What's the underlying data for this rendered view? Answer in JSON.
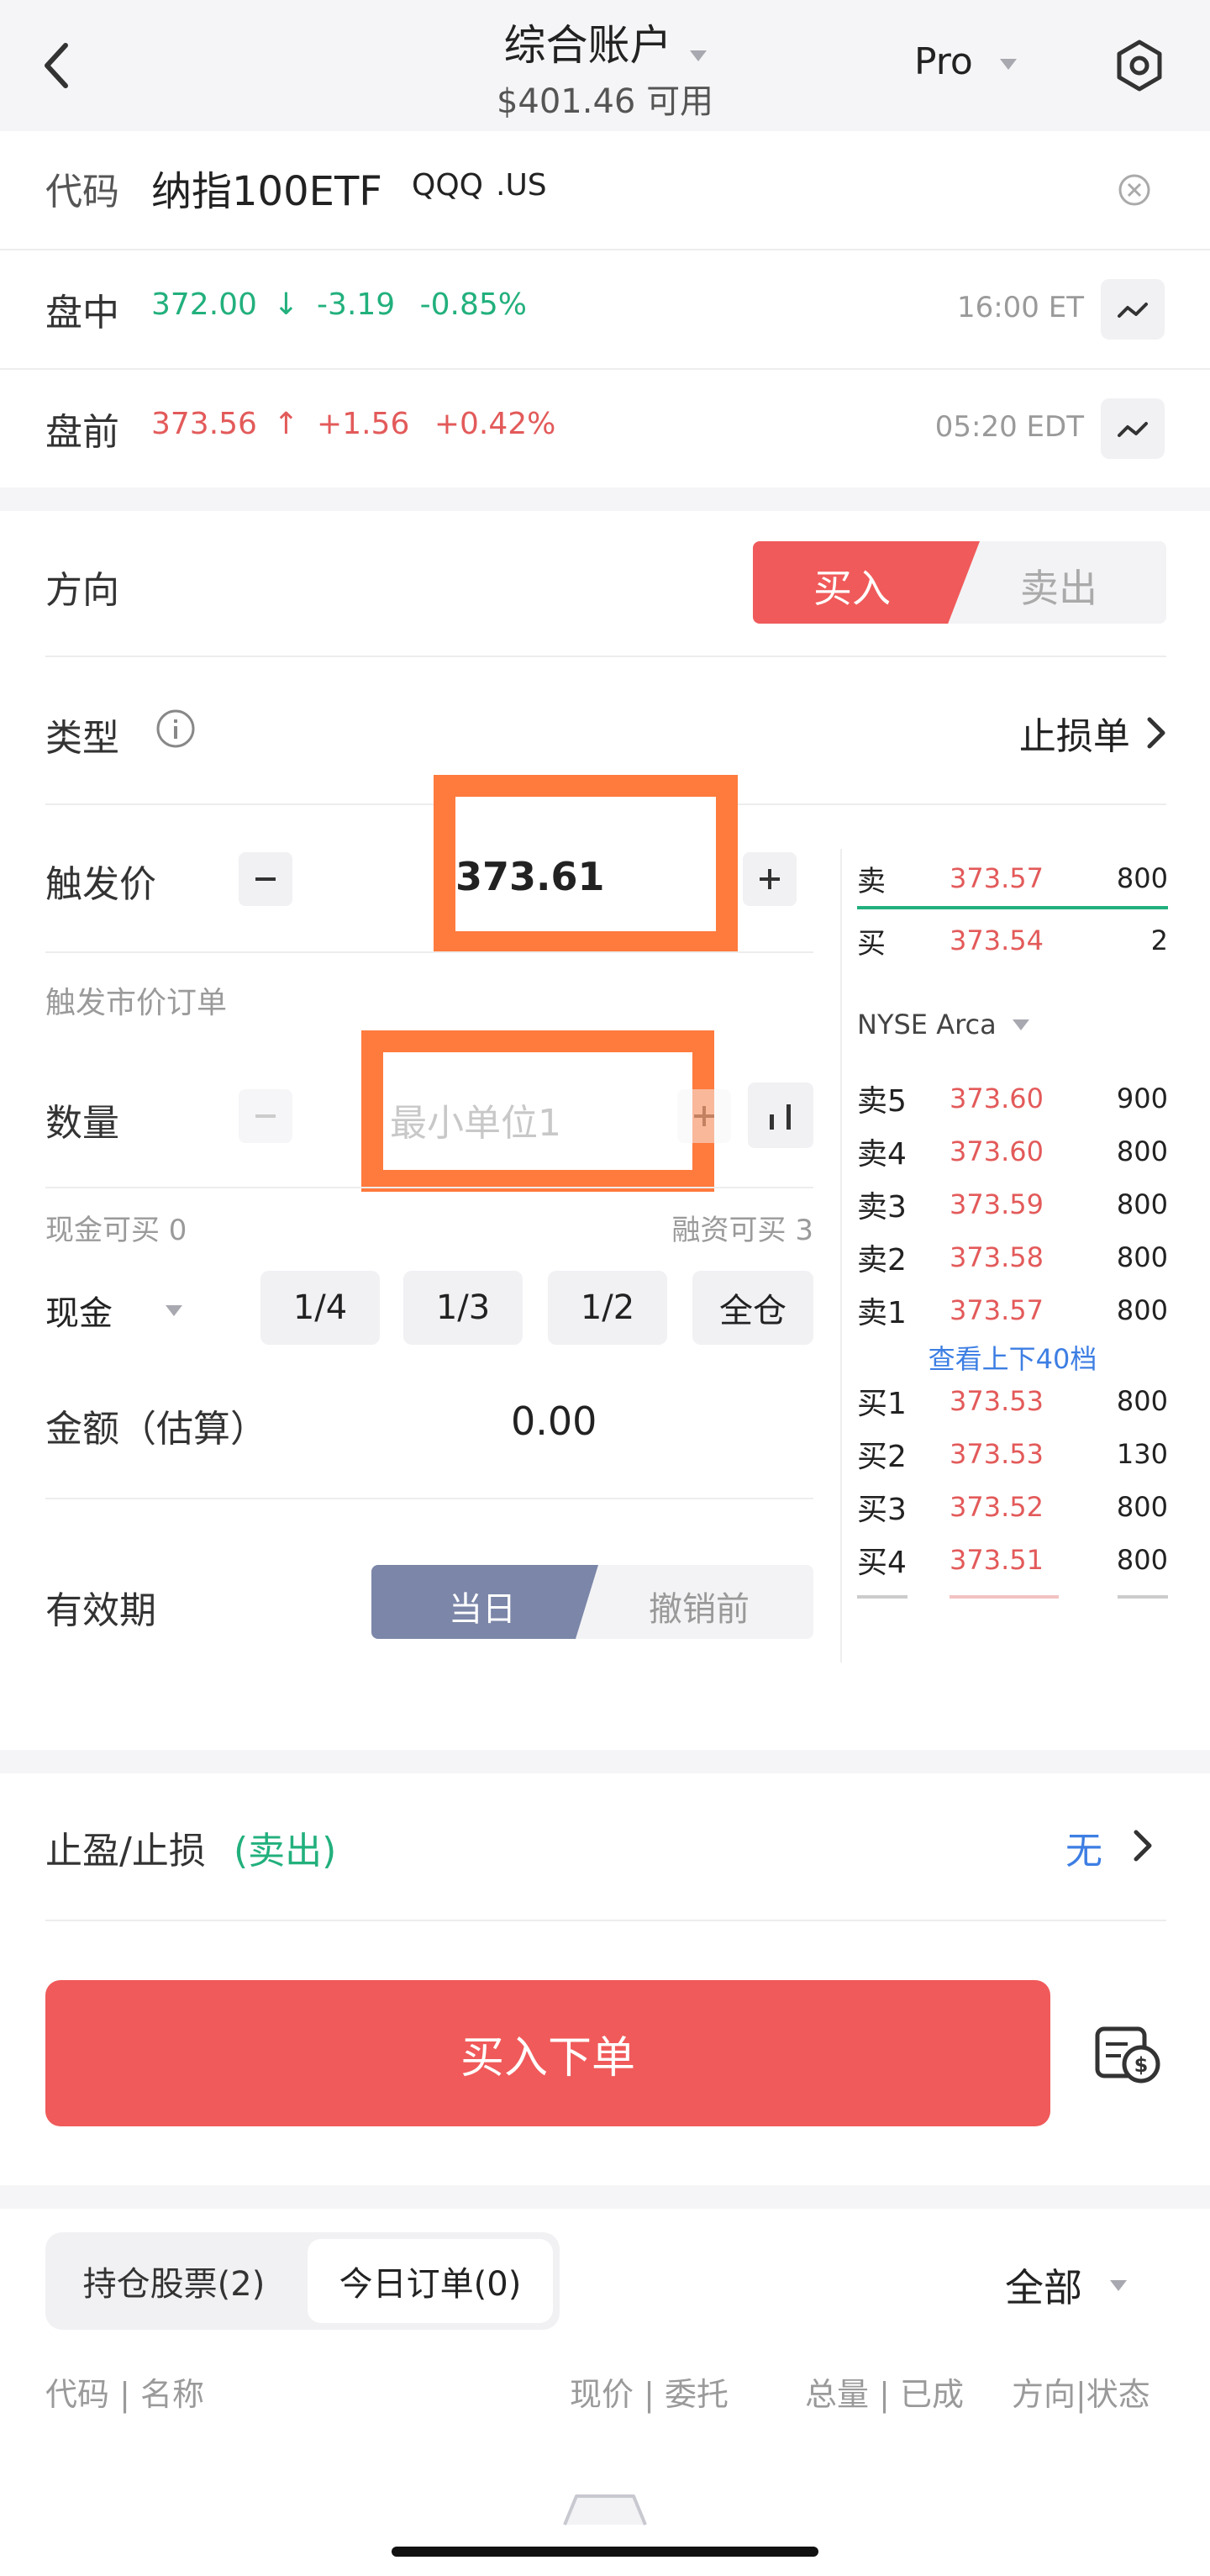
{
  "header": {
    "account_title": "综合账户",
    "available": "$401.46 可用",
    "mode": "Pro"
  },
  "quote": {
    "code_label": "代码",
    "name": "纳指100ETF",
    "ticker": "QQQ",
    "market": ".US",
    "intraday": {
      "label": "盘中",
      "price": "372.00",
      "arrow": "↓",
      "change": "-3.19",
      "pct": "-0.85%",
      "time": "16:00 ET"
    },
    "premarket": {
      "label": "盘前",
      "price": "373.56",
      "arrow": "↑",
      "change": "+1.56",
      "pct": "+0.42%",
      "time": "05:20 EDT"
    }
  },
  "order": {
    "direction_label": "方向",
    "buy": "买入",
    "sell": "卖出",
    "type_label": "类型",
    "type_value": "止损单",
    "trigger_label": "触发价",
    "trigger_value": "373.61",
    "trigger_hint": "触发市价订单",
    "qty_label": "数量",
    "qty_placeholder": "最小单位1",
    "cash_can_buy": "现金可买 0",
    "margin_can_buy": "融资可买 3",
    "pay_method": "现金",
    "fractions": [
      "1/4",
      "1/3",
      "1/2",
      "全仓"
    ],
    "amount_label": "金额（估算）",
    "amount_value": "0.00",
    "validity_label": "有效期",
    "validity_day": "当日",
    "validity_gtc": "撤销前"
  },
  "orderbook": {
    "top_ask": {
      "label": "卖",
      "price": "373.57",
      "qty": "800"
    },
    "top_bid": {
      "label": "买",
      "price": "373.54",
      "qty": "2"
    },
    "exchange": "NYSE Arca",
    "asks": [
      {
        "label": "卖5",
        "price": "373.60",
        "qty": "900"
      },
      {
        "label": "卖4",
        "price": "373.60",
        "qty": "800"
      },
      {
        "label": "卖3",
        "price": "373.59",
        "qty": "800"
      },
      {
        "label": "卖2",
        "price": "373.58",
        "qty": "800"
      },
      {
        "label": "卖1",
        "price": "373.57",
        "qty": "800"
      }
    ],
    "view_more": "查看上下40档",
    "bids": [
      {
        "label": "买1",
        "price": "373.53",
        "qty": "800"
      },
      {
        "label": "买2",
        "price": "373.53",
        "qty": "130"
      },
      {
        "label": "买3",
        "price": "373.52",
        "qty": "800"
      },
      {
        "label": "买4",
        "price": "373.51",
        "qty": "800"
      }
    ]
  },
  "tp_sl": {
    "label": "止盈/止损",
    "side": "(卖出)",
    "value": "无"
  },
  "submit": "买入下单",
  "tabs": {
    "holdings": "持仓股票(2)",
    "today_orders": "今日订单(0)",
    "filter": "全部"
  },
  "columns": [
    "代码 | 名称",
    "现价 | 委托",
    "总量 | 已成",
    "方向|状态"
  ],
  "colors": {
    "buy_red": "#f05a5a",
    "green": "#22b07d",
    "red": "#e35a5a",
    "blue": "#3d7ee3",
    "highlight_orange": "#ff7a3d",
    "validity_active": "#7b86a8"
  }
}
